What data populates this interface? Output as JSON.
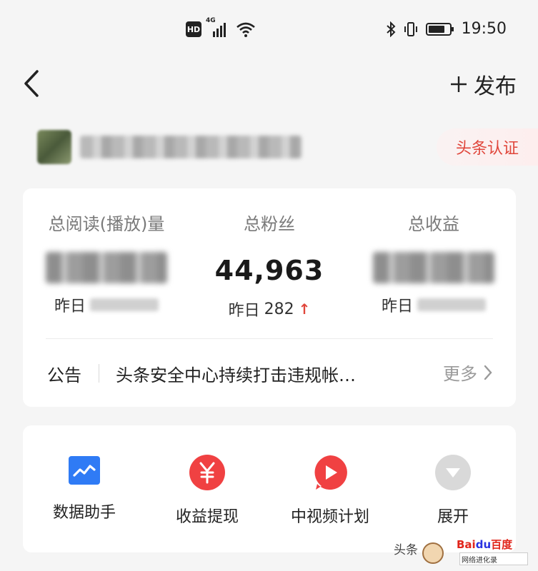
{
  "status_bar": {
    "hd": "HD",
    "network": "4G",
    "time": "19:50"
  },
  "nav": {
    "publish_label": "发布"
  },
  "user": {
    "cert_label": "头条认证"
  },
  "stats": {
    "total_reads_label": "总阅读(播放)量",
    "total_fans_label": "总粉丝",
    "total_fans_value": "44,963",
    "total_income_label": "总收益",
    "yesterday_prefix": "昨日",
    "fans_yesterday_value": "282"
  },
  "notice": {
    "label": "公告",
    "text": "头条安全中心持续打击违规帐…",
    "more_label": "更多"
  },
  "tools": [
    {
      "label": "数据助手",
      "icon": "chart-icon",
      "color": "#2f7bf5"
    },
    {
      "label": "收益提现",
      "icon": "yuan-icon",
      "color": "#f04142"
    },
    {
      "label": "中视频计划",
      "icon": "play-icon",
      "color": "#f04142"
    },
    {
      "label": "展开",
      "icon": "expand-icon",
      "color": "#d9d9d9"
    }
  ],
  "watermark": {
    "toutiao": "头条",
    "baidu_a": "Bai",
    "baidu_b": "du",
    "baidu_c": "百度",
    "sub": "网络进化录"
  }
}
